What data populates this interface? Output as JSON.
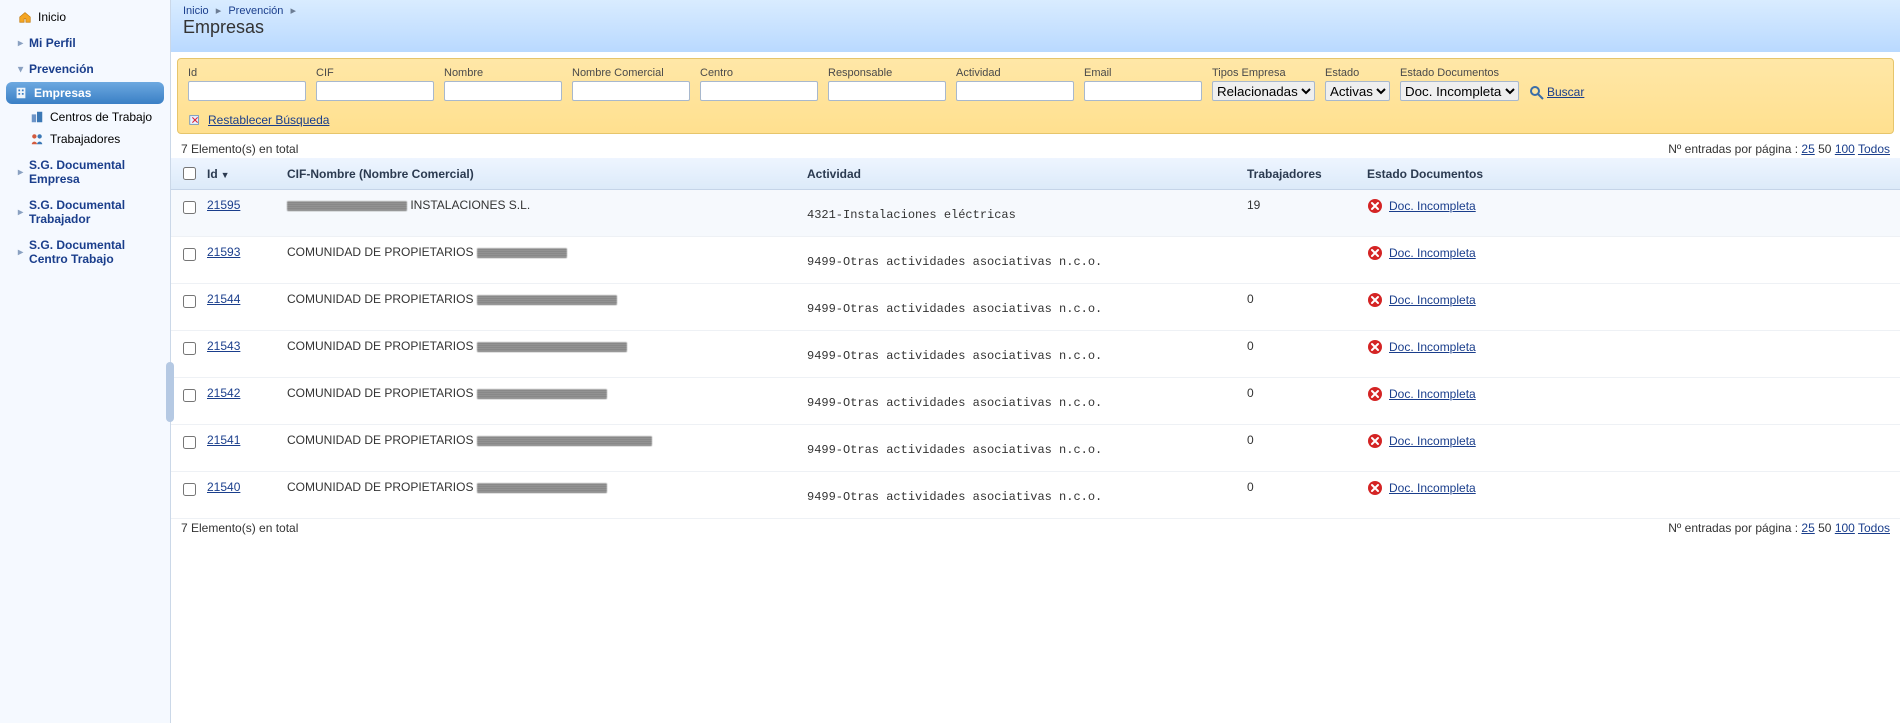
{
  "sidebar": {
    "inicio": "Inicio",
    "mi_perfil": "Mi Perfil",
    "prevencion": "Prevención",
    "empresas": "Empresas",
    "centros": "Centros de Trabajo",
    "trabajadores": "Trabajadores",
    "sg_empresa": "S.G. Documental Empresa",
    "sg_trabajador": "S.G. Documental Trabajador",
    "sg_centro": "S.G. Documental Centro Trabajo"
  },
  "breadcrumb": [
    "Inicio",
    "Prevención"
  ],
  "page_title": "Empresas",
  "search": {
    "fields": {
      "id": "Id",
      "cif": "CIF",
      "nombre": "Nombre",
      "nombre_comercial": "Nombre Comercial",
      "centro": "Centro",
      "responsable": "Responsable",
      "actividad": "Actividad",
      "email": "Email",
      "tipos_empresa": "Tipos Empresa",
      "estado": "Estado",
      "estado_docs": "Estado Documentos"
    },
    "select_tipos": "Relacionadas",
    "select_estado": "Activas",
    "select_estado_docs": "Doc. Incompleta",
    "buscar": "Buscar",
    "reset": "Restablecer Búsqueda"
  },
  "summary": {
    "count_text": "7 Elemento(s) en total",
    "pager_label": "Nº entradas por página :",
    "pager_opts": [
      "25",
      "50",
      "100",
      "Todos"
    ]
  },
  "table": {
    "headers": {
      "id": "Id",
      "cif": "CIF-Nombre (Nombre Comercial)",
      "actividad": "Actividad",
      "trabajadores": "Trabajadores",
      "estado_docs": "Estado Documentos"
    },
    "rows": [
      {
        "id": "21595",
        "cif_prefix": "",
        "cif_text": "INSTALACIONES S.L.",
        "actividad": "4321-Instalaciones eléctricas",
        "trab": "19",
        "estado": "Doc. Incompleta"
      },
      {
        "id": "21593",
        "cif_prefix": "COMUNIDAD DE PROPIETARIOS",
        "cif_text": "",
        "actividad": "9499-Otras actividades asociativas n.c.o.",
        "trab": "",
        "estado": "Doc. Incompleta"
      },
      {
        "id": "21544",
        "cif_prefix": "COMUNIDAD DE PROPIETARIOS",
        "cif_text": "",
        "actividad": "9499-Otras actividades asociativas n.c.o.",
        "trab": "0",
        "estado": "Doc. Incompleta"
      },
      {
        "id": "21543",
        "cif_prefix": "COMUNIDAD DE PROPIETARIOS",
        "cif_text": "",
        "actividad": "9499-Otras actividades asociativas n.c.o.",
        "trab": "0",
        "estado": "Doc. Incompleta"
      },
      {
        "id": "21542",
        "cif_prefix": "COMUNIDAD DE PROPIETARIOS",
        "cif_text": "",
        "actividad": "9499-Otras actividades asociativas n.c.o.",
        "trab": "0",
        "estado": "Doc. Incompleta"
      },
      {
        "id": "21541",
        "cif_prefix": "COMUNIDAD DE PROPIETARIOS",
        "cif_text": "",
        "actividad": "9499-Otras actividades asociativas n.c.o.",
        "trab": "0",
        "estado": "Doc. Incompleta"
      },
      {
        "id": "21540",
        "cif_prefix": "COMUNIDAD DE PROPIETARIOS",
        "cif_text": "",
        "actividad": "9499-Otras actividades asociativas n.c.o.",
        "trab": "0",
        "estado": "Doc. Incompleta"
      }
    ]
  }
}
